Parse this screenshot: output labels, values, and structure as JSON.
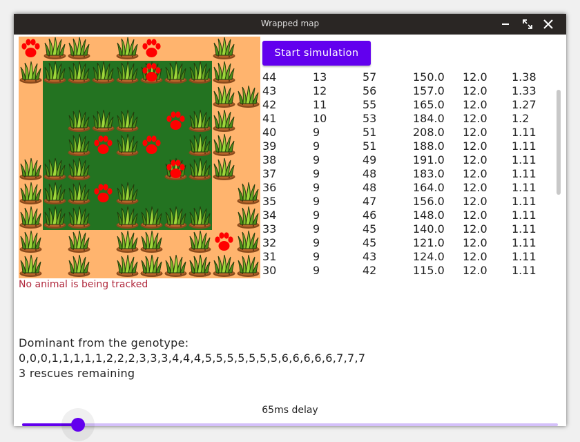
{
  "window": {
    "title": "Wrapped map"
  },
  "controls": {
    "start_label": "Start simulation"
  },
  "map": {
    "cols": 10,
    "rows": 10,
    "jungle": {
      "col": 1,
      "row": 1,
      "cols": 7,
      "rows": 7
    },
    "colors": {
      "steppe": "#ffb46e",
      "jungle": "#237321",
      "animal": "#ff0000"
    },
    "grass": [
      [
        0,
        1
      ],
      [
        1,
        1
      ],
      [
        2,
        1
      ],
      [
        3,
        1
      ],
      [
        4,
        1
      ],
      [
        5,
        1
      ],
      [
        6,
        1
      ],
      [
        7,
        1
      ],
      [
        8,
        1
      ],
      [
        8,
        2
      ],
      [
        9,
        2
      ],
      [
        2,
        3
      ],
      [
        3,
        3
      ],
      [
        4,
        3
      ],
      [
        7,
        3
      ],
      [
        8,
        3
      ],
      [
        2,
        4
      ],
      [
        4,
        4
      ],
      [
        7,
        4
      ],
      [
        8,
        4
      ],
      [
        0,
        5
      ],
      [
        1,
        5
      ],
      [
        2,
        5
      ],
      [
        6,
        5
      ],
      [
        7,
        5
      ],
      [
        8,
        5
      ],
      [
        0,
        6
      ],
      [
        1,
        6
      ],
      [
        2,
        6
      ],
      [
        4,
        6
      ],
      [
        9,
        6
      ],
      [
        0,
        7
      ],
      [
        1,
        7
      ],
      [
        2,
        7
      ],
      [
        4,
        7
      ],
      [
        5,
        7
      ],
      [
        6,
        7
      ],
      [
        7,
        7
      ],
      [
        9,
        7
      ],
      [
        0,
        8
      ],
      [
        2,
        8
      ],
      [
        4,
        8
      ],
      [
        5,
        8
      ],
      [
        7,
        8
      ],
      [
        9,
        8
      ],
      [
        2,
        9
      ],
      [
        4,
        9
      ],
      [
        5,
        9
      ],
      [
        6,
        9
      ],
      [
        7,
        9
      ],
      [
        0,
        10
      ],
      [
        5,
        10
      ],
      [
        7,
        10
      ],
      [
        8,
        10
      ],
      [
        9,
        10
      ],
      [
        1,
        0
      ],
      [
        2,
        0
      ],
      [
        4,
        0
      ],
      [
        8,
        0
      ]
    ],
    "animals": [
      [
        0,
        0
      ],
      [
        5,
        0
      ],
      [
        5,
        1
      ],
      [
        6,
        3
      ],
      [
        3,
        4
      ],
      [
        5,
        4
      ],
      [
        6,
        5
      ],
      [
        3,
        6
      ],
      [
        8,
        8
      ]
    ]
  },
  "stats": {
    "rows": [
      [
        "44",
        "13",
        "57",
        "150.0",
        "12.0",
        "1.38"
      ],
      [
        "43",
        "12",
        "56",
        "157.0",
        "12.0",
        "1.33"
      ],
      [
        "42",
        "11",
        "55",
        "165.0",
        "12.0",
        "1.27"
      ],
      [
        "41",
        "10",
        "53",
        "184.0",
        "12.0",
        "1.2"
      ],
      [
        "40",
        "9",
        "51",
        "208.0",
        "12.0",
        "1.11"
      ],
      [
        "39",
        "9",
        "51",
        "188.0",
        "12.0",
        "1.11"
      ],
      [
        "38",
        "9",
        "49",
        "191.0",
        "12.0",
        "1.11"
      ],
      [
        "37",
        "9",
        "48",
        "183.0",
        "12.0",
        "1.11"
      ],
      [
        "36",
        "9",
        "48",
        "164.0",
        "12.0",
        "1.11"
      ],
      [
        "35",
        "9",
        "47",
        "156.0",
        "12.0",
        "1.11"
      ],
      [
        "34",
        "9",
        "46",
        "148.0",
        "12.0",
        "1.11"
      ],
      [
        "33",
        "9",
        "45",
        "140.0",
        "12.0",
        "1.11"
      ],
      [
        "32",
        "9",
        "45",
        "121.0",
        "12.0",
        "1.11"
      ],
      [
        "31",
        "9",
        "43",
        "124.0",
        "12.0",
        "1.11"
      ],
      [
        "30",
        "9",
        "42",
        "115.0",
        "12.0",
        "1.11"
      ]
    ]
  },
  "tracking": {
    "status": "No animal is being tracked"
  },
  "genotype": {
    "heading": "Dominant from the genotype:",
    "value": "0,0,0,1,1,1,1,1,2,2,2,3,3,3,4,4,4,5,5,5,5,5,5,5,6,6,6,6,6,7,7,7"
  },
  "rescues": {
    "text": "3 rescues remaining"
  },
  "delay": {
    "label": "65ms delay",
    "fraction": 0.105
  },
  "colors": {
    "accent": "#6200ee",
    "accent_light": "#d4c0fa",
    "title_bar": "#2a2624",
    "status_text": "#b0283c"
  },
  "icons": {
    "grass": "grass-tuft-icon",
    "animal": "paw-print-icon",
    "minimize": "minimize-icon",
    "maximize": "maximize-icon",
    "close": "close-icon"
  }
}
